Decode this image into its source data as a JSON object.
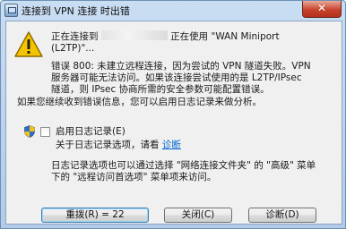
{
  "window": {
    "title": "连接到 VPN 连接 时出错",
    "close_glyph": "✕"
  },
  "message": {
    "line1_prefix": "正在连接到",
    "line1_suffix": "正在使用 \"WAN Miniport",
    "line2": "(L2TP)\"...",
    "error_lines": [
      "错误 800: 未建立远程连接，因为尝试的 VPN 隧道失败。VPN",
      "服务器可能无法访问。如果该连接尝试使用的是 L2TP/IPsec",
      "隧道，则 IPsec 协商所需的安全参数可能配置错误。"
    ],
    "persist_note": "如果您继续收到错误信息，您可以启用日志记录来做分析。"
  },
  "logging": {
    "checkbox_label": "启用日志记录(E)",
    "checked": false,
    "about_prefix": "关于日志记录选项，请看",
    "diagnose_link": "诊断",
    "info_lines": [
      "日志记录选项也可以通过选择 \"网络连接文件夹\" 的 \"高级\" 菜单",
      "下的 \"远程访问首选项\" 菜单项来访问。"
    ]
  },
  "buttons": {
    "redial": "重拨(R) = 22",
    "close": "关闭(C)",
    "diagnose": "诊断(D)"
  },
  "icons": {
    "title_icon": "network-connection-icon",
    "warning": "warning-icon",
    "shield": "uac-shield-icon"
  },
  "colors": {
    "link": "#0066cc",
    "warning": "#f5c400",
    "close_button": "#c8432d"
  }
}
